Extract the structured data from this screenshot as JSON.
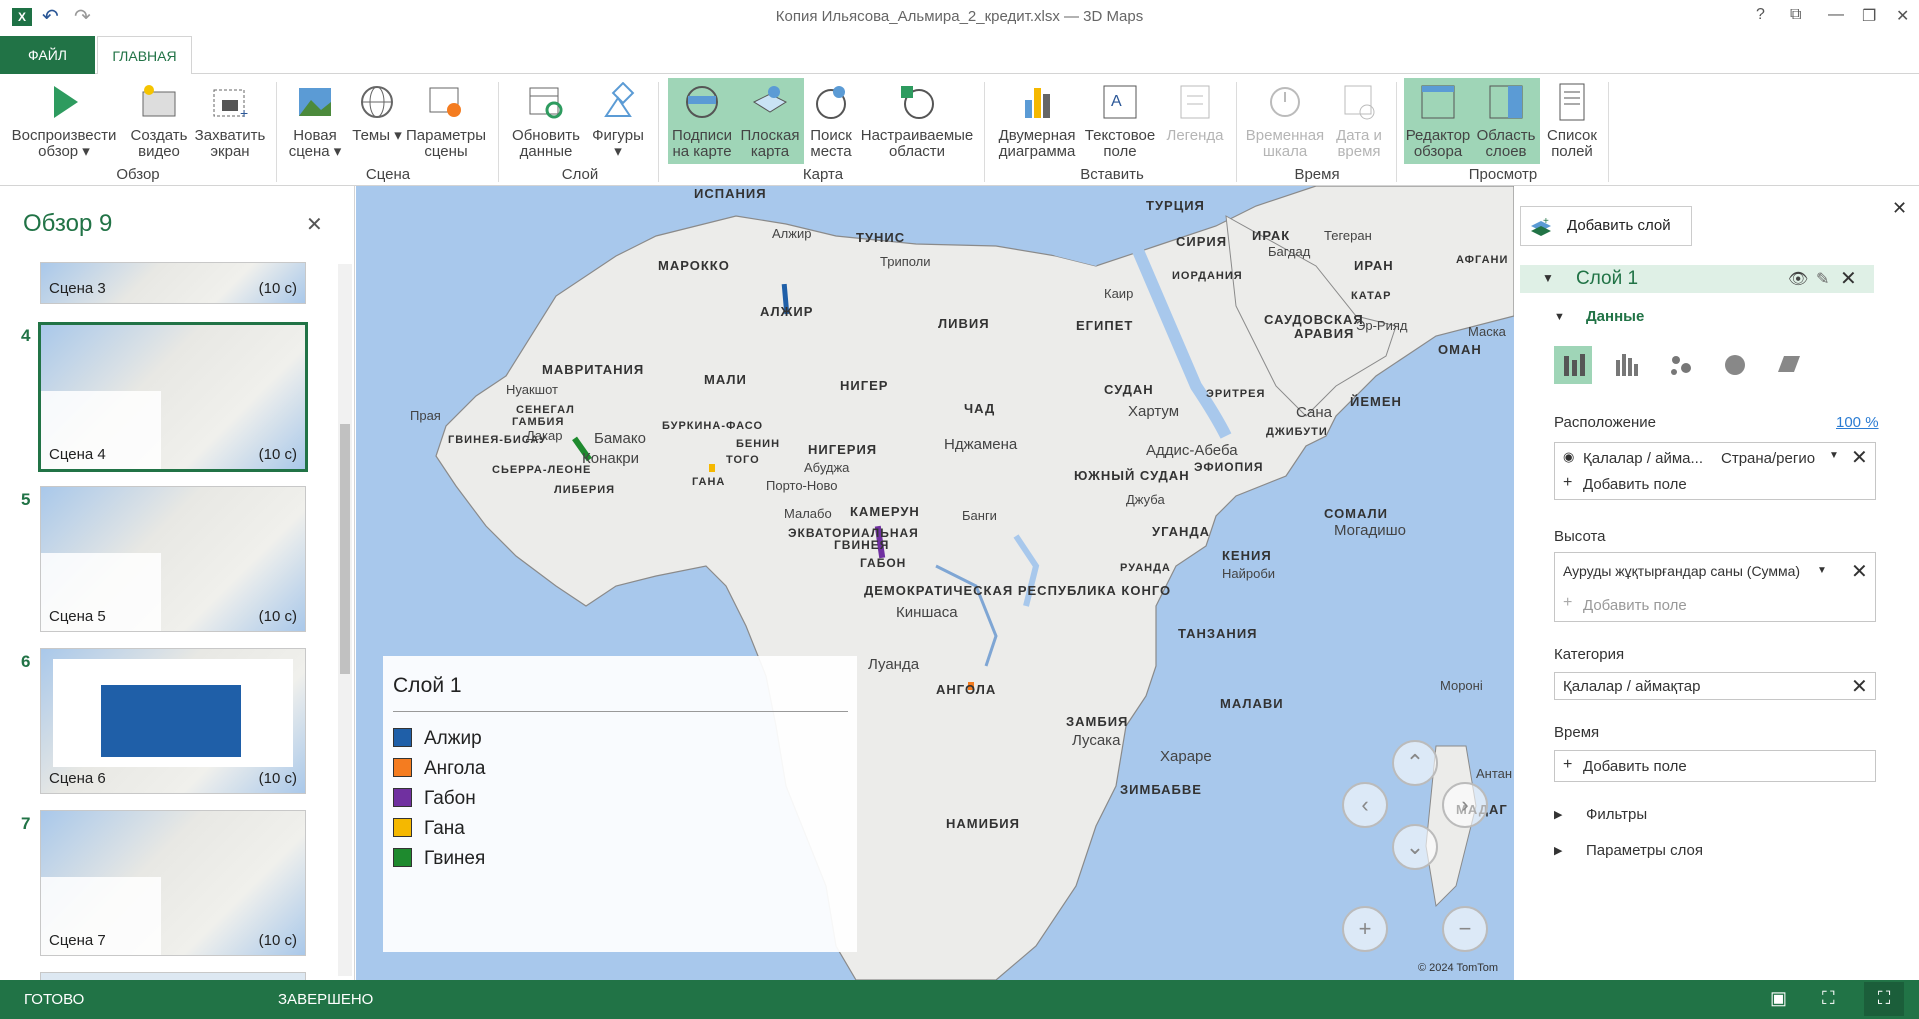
{
  "titlebar": {
    "title": "Копия Ильясова_Альмира_2_кредит.xlsx — 3D Maps",
    "app_icon": "X",
    "help": "?"
  },
  "tabs": {
    "file": "ФАЙЛ",
    "home": "ГЛАВНАЯ"
  },
  "ribbon": {
    "buttons": {
      "play": "Воспроизвести обзор ▾",
      "video": "Создать видео",
      "capture": "Захватить экран",
      "new_scene": "Новая сцена ▾",
      "themes": "Темы ▾",
      "scene_params": "Параметры сцены",
      "refresh": "Обновить данные",
      "shapes": "Фигуры ▾",
      "map_labels": "Подписи на карте",
      "flat_map": "Плоская карта",
      "find_place": "Поиск места",
      "custom_regions": "Настраиваемые области",
      "chart2d": "Двумерная диаграмма",
      "textbox": "Текстовое поле",
      "legend": "Легенда",
      "timeline": "Временная шкала",
      "datetime": "Дата и время",
      "tour_editor": "Редактор обзора",
      "layer_pane": "Область слоев",
      "field_list": "Список полей"
    },
    "groups": {
      "tour": "Обзор",
      "scene": "Сцена",
      "layer": "Слой",
      "map": "Карта",
      "insert": "Вставить",
      "time": "Время",
      "view": "Просмотр"
    }
  },
  "tour_panel": {
    "title": "Обзор 9",
    "scenes": [
      {
        "num": "",
        "caption": "Сцена 3",
        "duration": "(10 с)"
      },
      {
        "num": "4",
        "caption": "Сцена 4",
        "duration": "(10 с)"
      },
      {
        "num": "5",
        "caption": "Сцена 5",
        "duration": "(10 с)"
      },
      {
        "num": "6",
        "caption": "Сцена 6",
        "duration": "(10 с)"
      },
      {
        "num": "7",
        "caption": "Сцена 7",
        "duration": "(10 с)"
      }
    ]
  },
  "map": {
    "countries": [
      "ИСПАНИЯ",
      "ТУНИС",
      "МАРОККО",
      "АЛЖИР",
      "ЛИВИЯ",
      "ЕГИПЕТ",
      "ТУРЦИЯ",
      "СИРИЯ",
      "ИРАК",
      "ИРАН",
      "ИОРДАНИЯ",
      "АФГАНИ",
      "КАТАР",
      "САУДОВСКАЯ",
      "АРАВИЯ",
      "ОМАН",
      "ЙЕМЕН",
      "МАВРИТАНИЯ",
      "МАЛИ",
      "НИГЕР",
      "ЧАД",
      "СУДАН",
      "ЭРИТРЕЯ",
      "ДЖИБУТИ",
      "СЕНЕГАЛ",
      "ГАМБИЯ",
      "ГВИНЕЯ-БИСАУ",
      "БУРКИНА-ФАСО",
      "БЕНИН",
      "ТОГО",
      "НИГЕРИЯ",
      "СЬЕРРА-ЛЕОНЕ",
      "ЛИБЕРИЯ",
      "ГАНА",
      "КАМЕРУН",
      "ЭКВАТОРИАЛЬНАЯ",
      "ГВИНЕЯ",
      "ГАБОН",
      "ЮЖНЫЙ СУДАН",
      "ЭФИОПИЯ",
      "СОМАЛИ",
      "УГАНДА",
      "КЕНИЯ",
      "РУАНДА",
      "ДЕМОКРАТИЧЕСКАЯ РЕСПУБЛИКА КОНГО",
      "ТАНЗАНИЯ",
      "АНГОЛА",
      "ЗАМБИЯ",
      "МАЛАВИ",
      "ЗИМБАБВЕ",
      "НАМИБИЯ",
      "МАДАГ"
    ],
    "cities": [
      "Алжир",
      "Триполи",
      "Каир",
      "Багдад",
      "Тегеран",
      "Эр-Рияд",
      "Маска",
      "Нуакшот",
      "Прая",
      "Дакар",
      "Бамако",
      "Конакри",
      "Абуджа",
      "Порто-Ново",
      "Малабо",
      "Нджамена",
      "Хартум",
      "Сана",
      "Аддис-Абеба",
      "Джуба",
      "Банги",
      "Могадишо",
      "Найроби",
      "Киншаса",
      "Луанда",
      "Лусака",
      "Хараре",
      "Мороні",
      "Антан"
    ],
    "copyright": "© 2024 TomTom"
  },
  "legend": {
    "title": "Слой 1",
    "items": [
      {
        "label": "Алжир",
        "color": "#1f5fa8"
      },
      {
        "label": "Ангола",
        "color": "#f47c20"
      },
      {
        "label": "Габон",
        "color": "#7030a0"
      },
      {
        "label": "Гана",
        "color": "#f5b800"
      },
      {
        "label": "Гвинея",
        "color": "#1e8a2e"
      }
    ]
  },
  "layer_pane": {
    "add_layer": "Добавить слой",
    "layer_name": "Слой 1",
    "data_section": "Данные",
    "location": {
      "label": "Расположение",
      "percent": "100 %",
      "field": "Қалалар / айма...",
      "type": "Страна/регио",
      "add": "Добавить поле"
    },
    "height": {
      "label": "Высота",
      "field": "Ауруды жұқтырғандар саны (Сумма)",
      "add": "Добавить поле"
    },
    "category": {
      "label": "Категория",
      "field": "Қалалар / аймақтар"
    },
    "time": {
      "label": "Время",
      "add": "Добавить поле"
    },
    "filters": "Фильтры",
    "layer_params": "Параметры слоя"
  },
  "status": {
    "ready": "ГОТОВО",
    "done": "ЗАВЕРШЕНО"
  }
}
